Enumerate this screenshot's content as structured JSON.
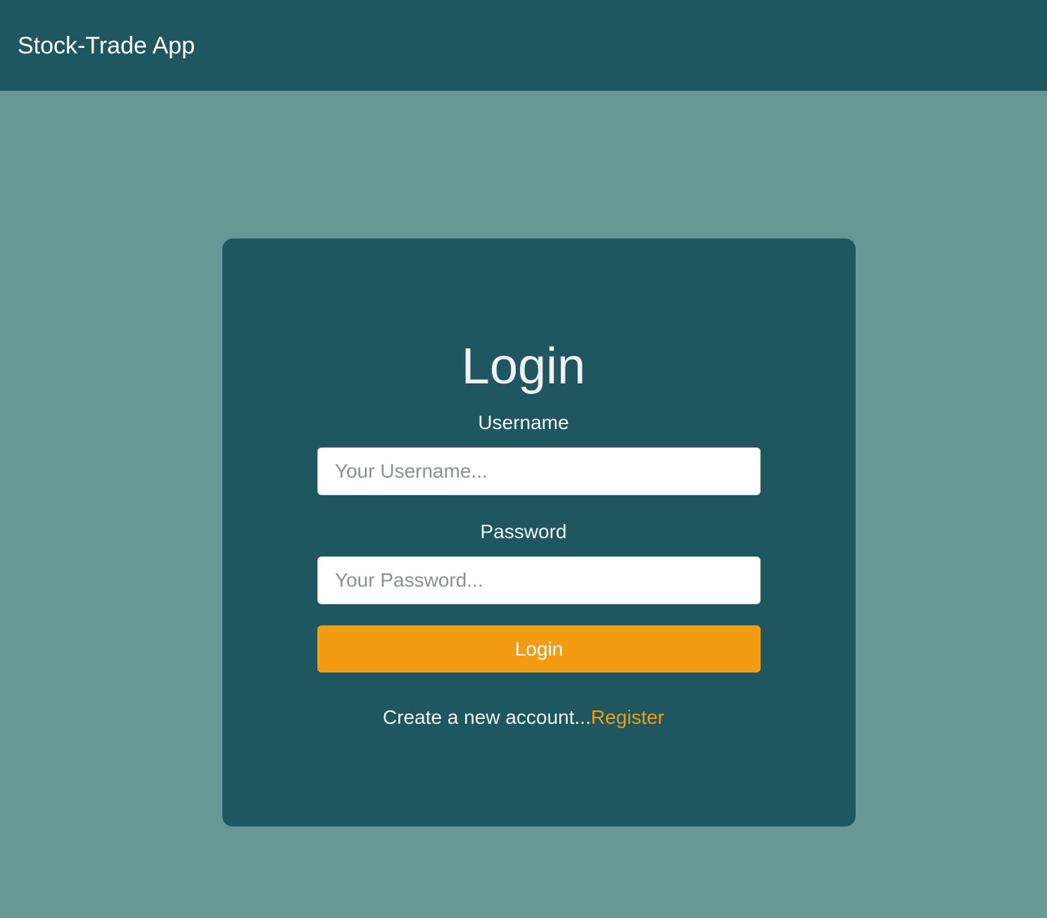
{
  "app": {
    "title": "Stock-Trade App"
  },
  "login_form": {
    "heading": "Login",
    "username": {
      "label": "Username",
      "placeholder": "Your Username...",
      "value": ""
    },
    "password": {
      "label": "Password",
      "placeholder": "Your Password...",
      "value": ""
    },
    "submit_label": "Login",
    "register_prompt": "Create a new account...",
    "register_link": "Register"
  },
  "colors": {
    "page_background": "#689896",
    "panel_background": "#1e5760",
    "accent": "#f39c12",
    "text": "#ffffff"
  }
}
